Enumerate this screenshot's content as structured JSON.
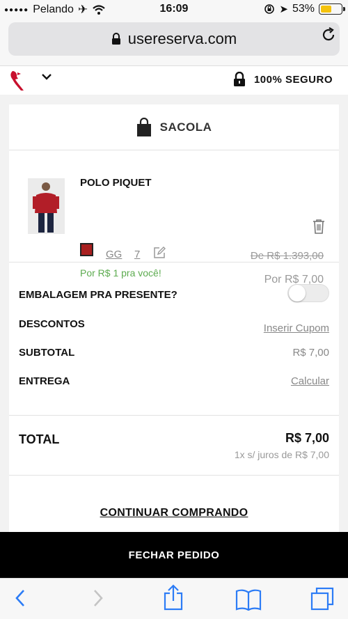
{
  "status_bar": {
    "carrier": "Pelando",
    "time": "16:09",
    "battery": "53%",
    "battery_level": 0.53
  },
  "browser": {
    "url": "usereserva.com"
  },
  "header": {
    "secure_label": "100% SEGURO"
  },
  "bag": {
    "title": "SACOLA",
    "item": {
      "name": "POLO PIQUET",
      "color": "#a81f1f",
      "size": "GG",
      "quantity": "7",
      "promo": "Por R$ 1 pra você!",
      "old_price": "De  R$ 1.393,00",
      "new_price": "Por  R$ 7,00"
    }
  },
  "summary": {
    "gift_label": "EMBALAGEM PRA PRESENTE?",
    "gift_enabled": false,
    "discounts_label": "DESCONTOS",
    "discounts_link": "Inserir Cupom",
    "subtotal_label": "SUBTOTAL",
    "subtotal_value": "R$ 7,00",
    "delivery_label": "ENTREGA",
    "delivery_link": "Calcular"
  },
  "total": {
    "label": "TOTAL",
    "value": "R$ 7,00",
    "installments": "1x s/ juros de R$ 7,00"
  },
  "actions": {
    "continue": "CONTINUAR COMPRANDO",
    "checkout": "FECHAR PEDIDO"
  },
  "colors": {
    "promo_green": "#5cab4f",
    "ios_blue": "#2c7cf6",
    "brand_red": "#c8102e"
  }
}
